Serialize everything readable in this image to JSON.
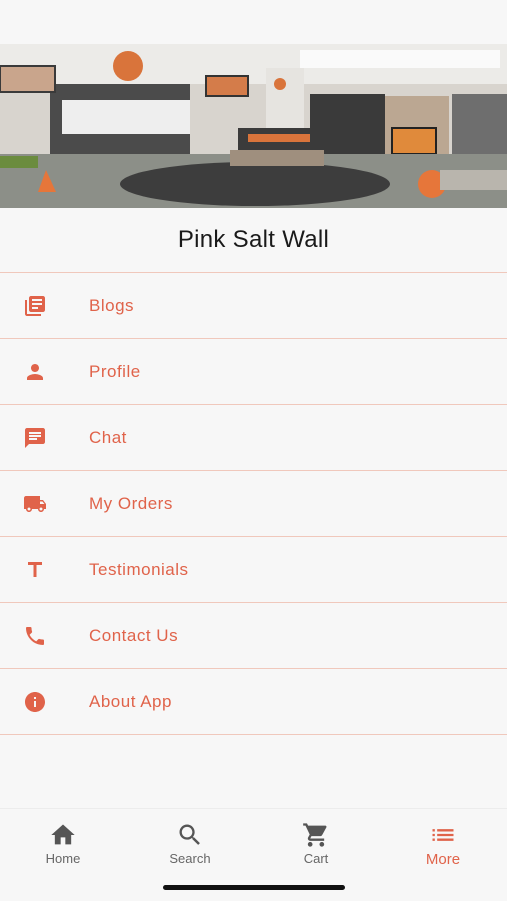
{
  "app": {
    "brand_title": "Pink Salt Wall"
  },
  "colors": {
    "accent": "#e0634a",
    "divider": "#f0c8bc",
    "tab_inactive": "#555555"
  },
  "menu": {
    "items": [
      {
        "label": "Blogs",
        "icon": "blog-icon"
      },
      {
        "label": "Profile",
        "icon": "person-icon"
      },
      {
        "label": "Chat",
        "icon": "chat-icon"
      },
      {
        "label": "My Orders",
        "icon": "truck-icon"
      },
      {
        "label": "Testimonials",
        "icon": "text-t-icon"
      },
      {
        "label": "Contact Us",
        "icon": "phone-icon"
      },
      {
        "label": "About App",
        "icon": "info-icon"
      }
    ]
  },
  "tabbar": {
    "tabs": [
      {
        "label": "Home",
        "icon": "home-icon",
        "active": false
      },
      {
        "label": "Search",
        "icon": "search-icon",
        "active": false
      },
      {
        "label": "Cart",
        "icon": "cart-icon",
        "active": false
      },
      {
        "label": "More",
        "icon": "list-icon",
        "active": true
      }
    ]
  }
}
